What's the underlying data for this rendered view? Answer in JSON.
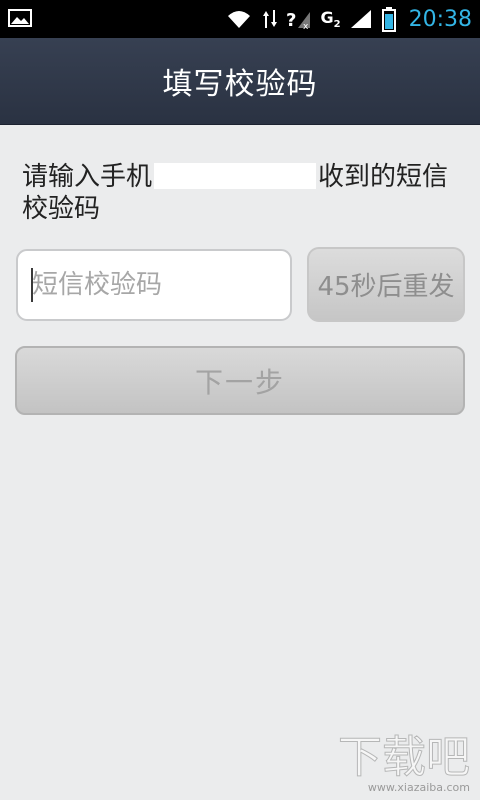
{
  "status_bar": {
    "time": "20:38",
    "network_label": "G",
    "icons": [
      "gallery-icon",
      "wifi-icon",
      "data-transfer-icon",
      "no-signal-icon",
      "network-type-icon",
      "signal-icon",
      "battery-icon"
    ]
  },
  "header": {
    "title": "填写校验码"
  },
  "form": {
    "instruction_prefix": "请输入手机",
    "instruction_suffix": "收到的短信校验码",
    "code_input_placeholder": "短信校验码",
    "code_input_value": "",
    "resend_button_label": "45秒后重发",
    "next_button_label": "下一步"
  },
  "watermark": {
    "site": "www.xiazaiba.com",
    "logo_text": "下载吧"
  },
  "colors": {
    "status_bar_bg": "#000000",
    "time_color": "#33b5e5",
    "title_bar_bg": "#2f3747",
    "content_bg": "#ebeced",
    "disabled_button_bg": "#cfcfcf",
    "disabled_text": "#a3a3a3"
  }
}
